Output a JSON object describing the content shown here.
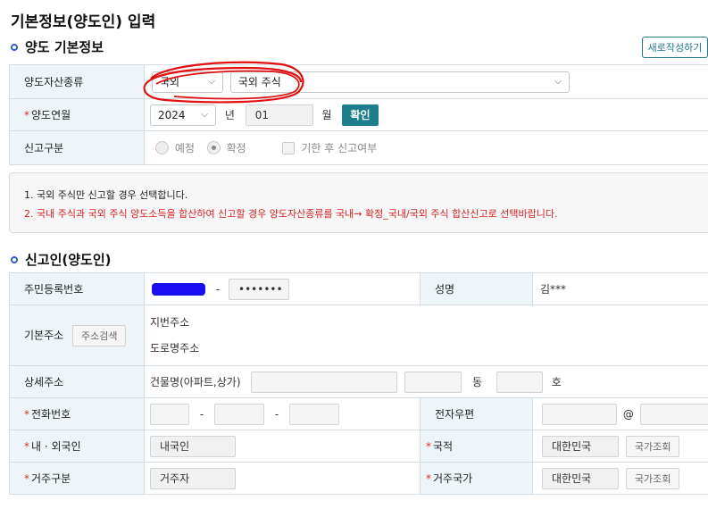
{
  "page_title": "기본정보(양도인) 입력",
  "section1": {
    "title": "양도 기본정보",
    "new_button": "새로작성하기",
    "asset_type": {
      "label": "양도자산종류",
      "region": "국외",
      "asset": "국외 주식"
    },
    "transfer_date": {
      "label": "양도연월",
      "year": "2024",
      "year_unit": "년",
      "month": "01",
      "month_unit": "월",
      "confirm": "확인"
    },
    "report_type": {
      "label": "신고구분",
      "opt1": "예정",
      "opt2": "확정",
      "late": "기한 후 신고여부"
    }
  },
  "notice": {
    "line1": "1. 국외 주식만 신고할 경우 선택합니다.",
    "line2": "2. 국내 주식과 국외 주식 양도소득을 합산하여 신고할 경우 양도자산종류를 국내→ 확정_국내/국외 주식 합산신고로 선택바랍니다."
  },
  "section2": {
    "title": "신고인(양도인)",
    "rrn": {
      "label": "주민등록번호",
      "dash": "-",
      "masked": "•••••••"
    },
    "name": {
      "label": "성명",
      "value": "김***"
    },
    "address": {
      "label": "기본주소",
      "search": "주소검색",
      "jibun": "지번주소",
      "road": "도로명주소"
    },
    "detail": {
      "label": "상세주소",
      "building": "건물명(아파트,상가)",
      "dong": "동",
      "ho": "호"
    },
    "phone": {
      "label": "전화번호",
      "dash": "-"
    },
    "email": {
      "label": "전자우편",
      "at": "@"
    },
    "nationality_type": {
      "label": "내 · 외국인",
      "value": "내국인"
    },
    "nationality": {
      "label": "국적",
      "value": "대한민국",
      "lookup": "국가조회"
    },
    "residence": {
      "label": "거주구분",
      "value": "거주자"
    },
    "residence_country": {
      "label": "거주국가",
      "value": "대한민국",
      "lookup": "국가조회"
    }
  },
  "colors": {
    "accent": "#1d7f8e",
    "required": "#d63333",
    "label_bg": "#eef5f8",
    "highlight_circle": "#e01010",
    "mask": "#1a0ef0"
  }
}
